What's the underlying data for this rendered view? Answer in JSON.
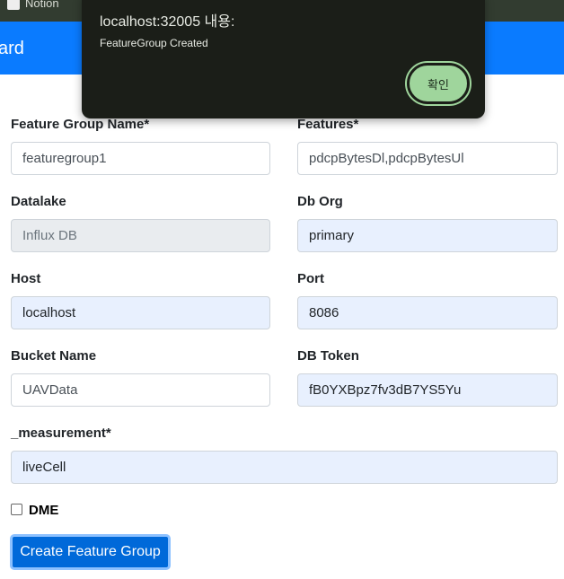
{
  "bookmarks": {
    "items": [
      {
        "label": "Notion"
      }
    ]
  },
  "header": {
    "title": "ard"
  },
  "form": {
    "feature_group_name": {
      "label": "Feature Group Name*",
      "value": "featuregroup1"
    },
    "features": {
      "label": "Features*",
      "value": "pdcpBytesDl,pdcpBytesUl"
    },
    "datalake": {
      "label": "Datalake",
      "value": "Influx DB"
    },
    "db_org": {
      "label": "Db Org",
      "value": "primary"
    },
    "host": {
      "label": "Host",
      "value": "localhost"
    },
    "port": {
      "label": "Port",
      "value": "8086"
    },
    "bucket_name": {
      "label": "Bucket Name",
      "value": "UAVData"
    },
    "db_token": {
      "label": "DB Token",
      "value": "fB0YXBpz7fv3dB7YS5Yu"
    },
    "measurement": {
      "label": "_measurement*",
      "value": "liveCell"
    },
    "dme": {
      "label": "DME",
      "checked": false
    },
    "submit_label": "Create Feature Group"
  },
  "dialog": {
    "title": "localhost:32005 내용:",
    "message": "FeatureGroup Created",
    "ok_label": "확인"
  }
}
